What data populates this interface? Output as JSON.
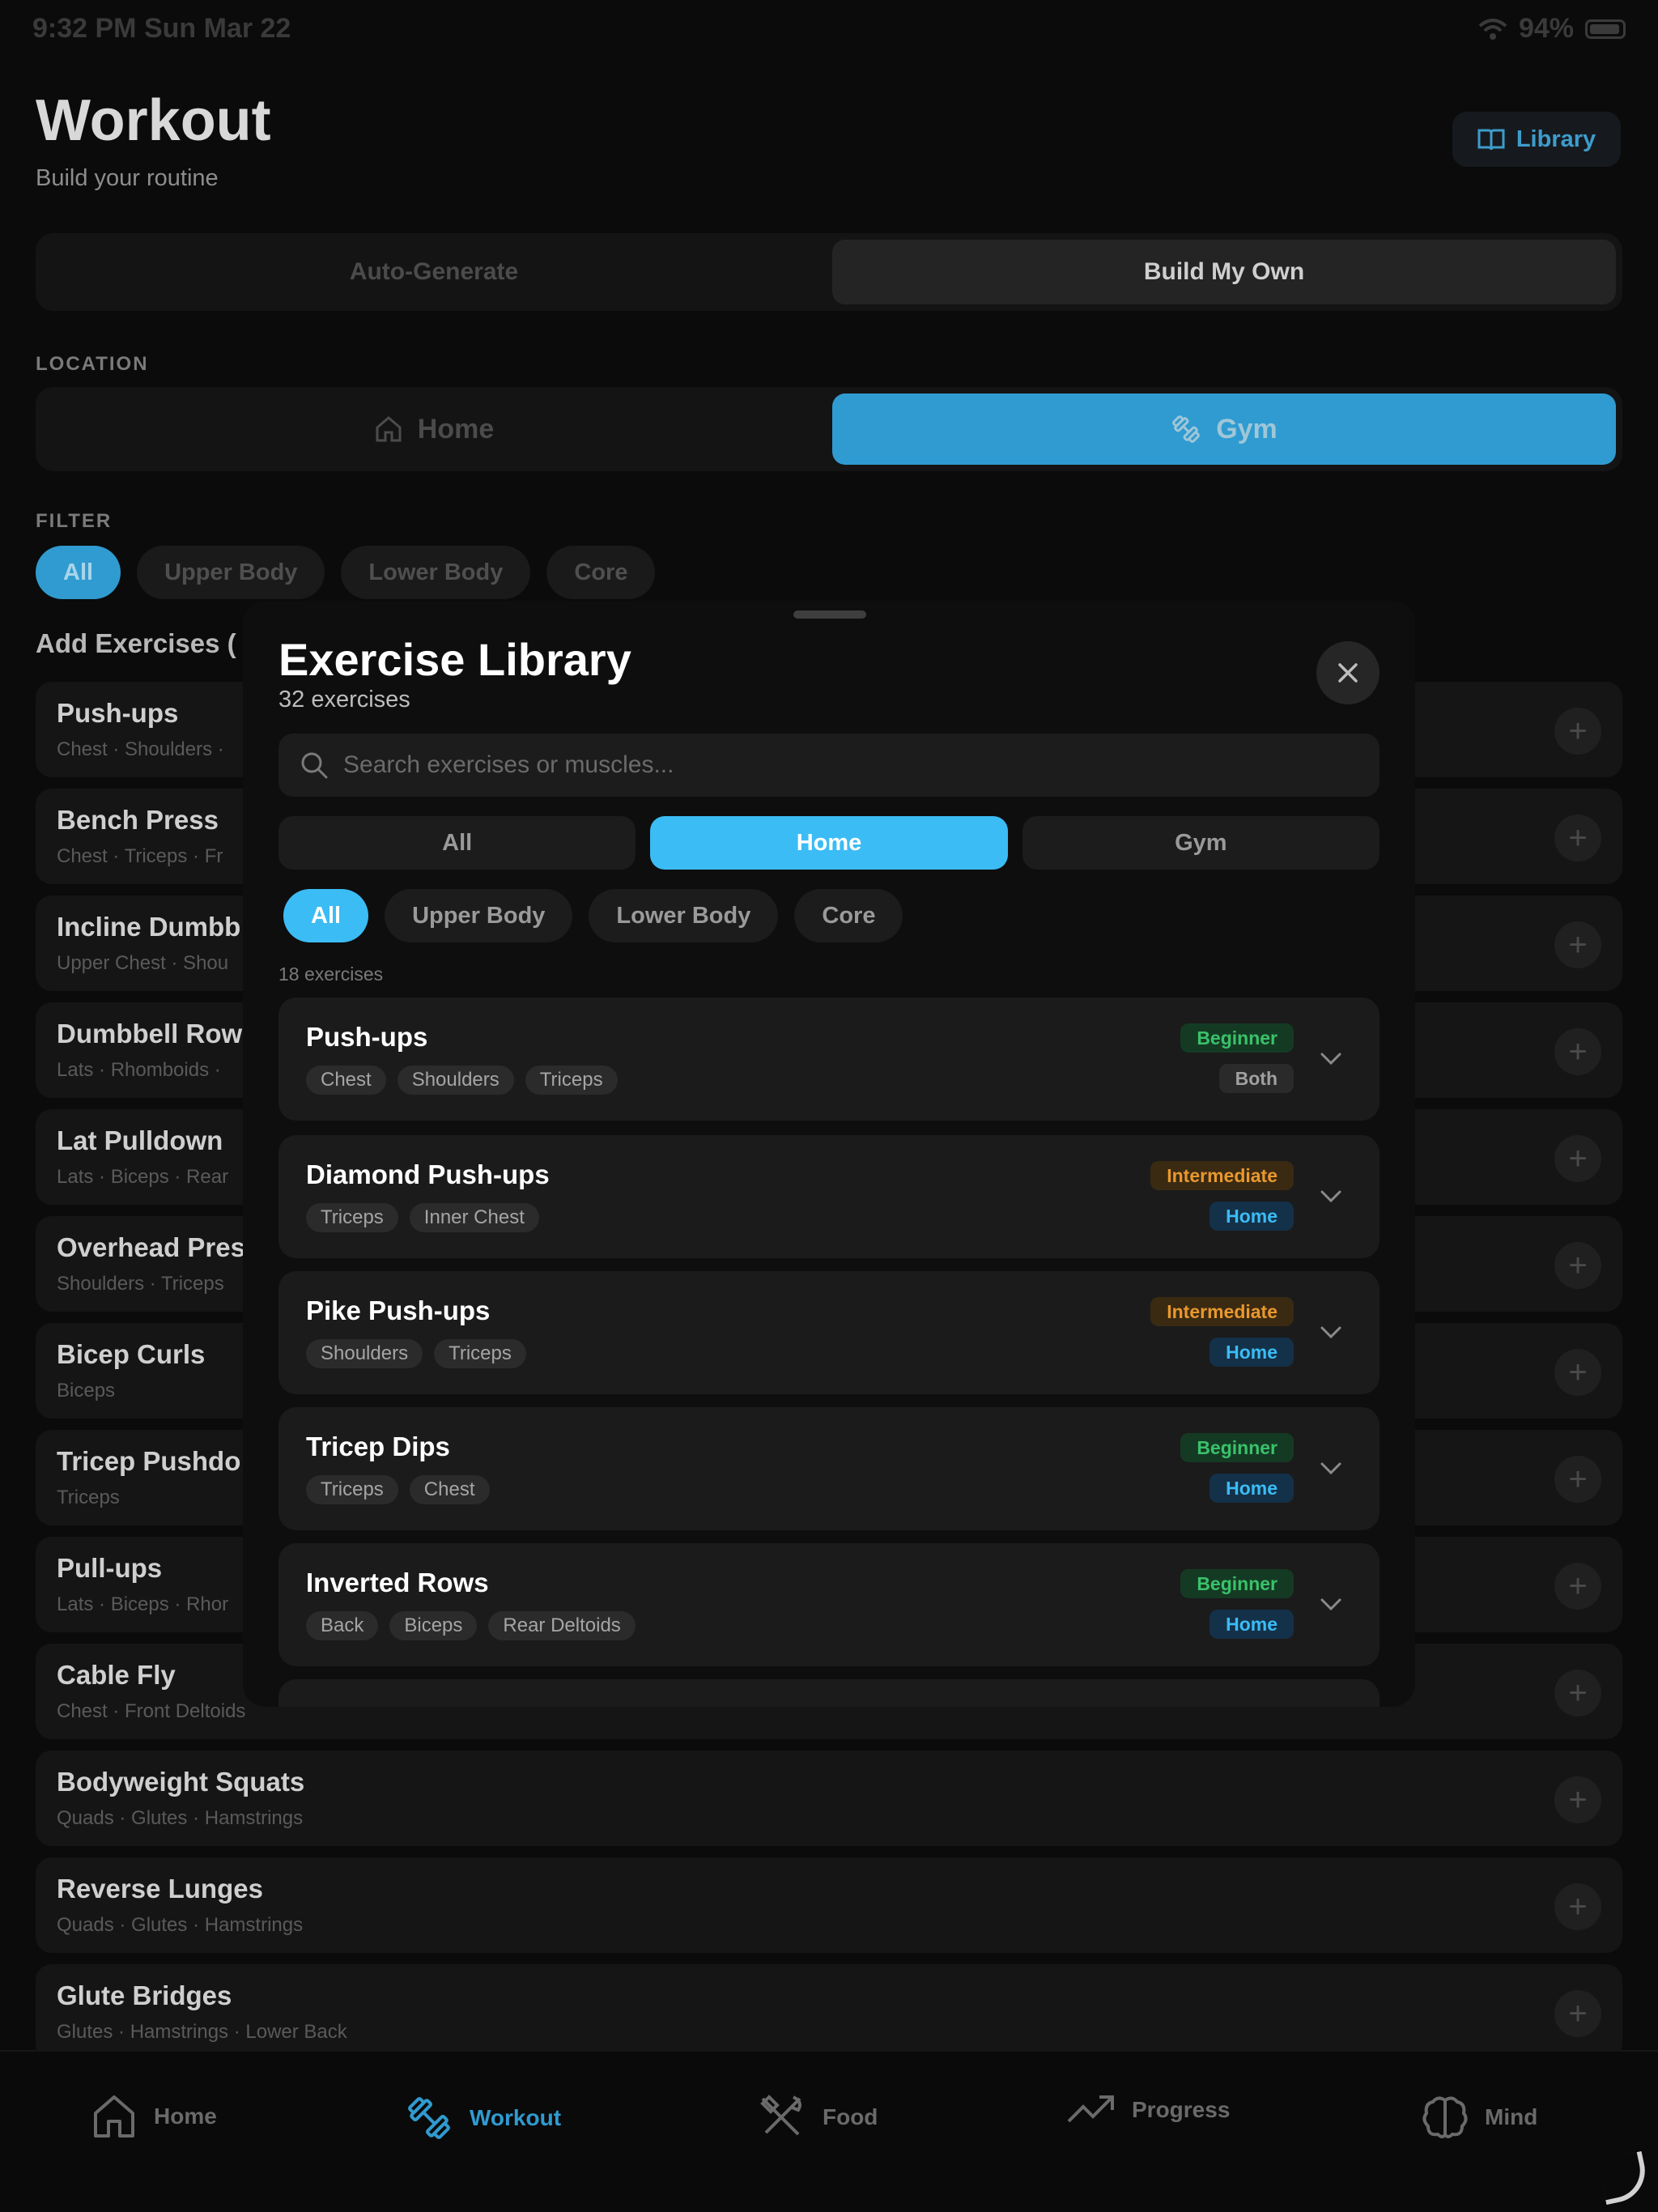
{
  "status_bar": {
    "time": "9:32 PM  Sun Mar 22",
    "battery": "94%"
  },
  "header": {
    "title": "Workout",
    "subtitle": "Build your routine",
    "library_label": "Library"
  },
  "mode_tabs": [
    "Auto-Generate",
    "Build My Own"
  ],
  "location": {
    "label": "LOCATION",
    "options": [
      "Home",
      "Gym"
    ],
    "selected": "Gym"
  },
  "filter": {
    "label": "FILTER",
    "options": [
      "All",
      "Upper Body",
      "Lower Body",
      "Core"
    ],
    "selected": "All"
  },
  "add_exercises_title": "Add Exercises (",
  "background_exercises": [
    {
      "name": "Push-ups",
      "muscles": "Chest · Shoulders ·"
    },
    {
      "name": "Bench Press",
      "muscles": "Chest · Triceps · Fr"
    },
    {
      "name": "Incline Dumbb",
      "muscles": "Upper Chest · Shou"
    },
    {
      "name": "Dumbbell Row",
      "muscles": "Lats · Rhomboids ·"
    },
    {
      "name": "Lat Pulldown",
      "muscles": "Lats · Biceps · Rear"
    },
    {
      "name": "Overhead Pres",
      "muscles": "Shoulders · Triceps"
    },
    {
      "name": "Bicep Curls",
      "muscles": "Biceps"
    },
    {
      "name": "Tricep Pushdo",
      "muscles": "Triceps"
    },
    {
      "name": "Pull-ups",
      "muscles": "Lats · Biceps · Rhor"
    },
    {
      "name": "Cable Fly",
      "muscles": "Chest · Front Deltoids"
    },
    {
      "name": "Bodyweight Squats",
      "muscles": "Quads · Glutes · Hamstrings"
    },
    {
      "name": "Reverse Lunges",
      "muscles": "Quads · Glutes · Hamstrings"
    },
    {
      "name": "Glute Bridges",
      "muscles": "Glutes · Hamstrings · Lower Back"
    }
  ],
  "sheet": {
    "title": "Exercise Library",
    "count": "32 exercises",
    "search_placeholder": "Search exercises or muscles...",
    "location_tabs": [
      "All",
      "Home",
      "Gym"
    ],
    "location_selected": "Home",
    "category_chips": [
      "All",
      "Upper Body",
      "Lower Body",
      "Core"
    ],
    "category_selected": "All",
    "result_count": "18 exercises",
    "exercises": [
      {
        "name": "Push-ups",
        "tags": [
          "Chest",
          "Shoulders",
          "Triceps"
        ],
        "difficulty": "Beginner",
        "location": "Both"
      },
      {
        "name": "Diamond Push-ups",
        "tags": [
          "Triceps",
          "Inner Chest"
        ],
        "difficulty": "Intermediate",
        "location": "Home"
      },
      {
        "name": "Pike Push-ups",
        "tags": [
          "Shoulders",
          "Triceps"
        ],
        "difficulty": "Intermediate",
        "location": "Home"
      },
      {
        "name": "Tricep Dips",
        "tags": [
          "Triceps",
          "Chest"
        ],
        "difficulty": "Beginner",
        "location": "Home"
      },
      {
        "name": "Inverted Rows",
        "tags": [
          "Back",
          "Biceps",
          "Rear Deltoids"
        ],
        "difficulty": "Beginner",
        "location": "Home"
      }
    ]
  },
  "tab_bar": {
    "items": [
      {
        "label": "Home",
        "icon": "house-icon"
      },
      {
        "label": "Workout",
        "icon": "dumbbell-icon"
      },
      {
        "label": "Food",
        "icon": "utensils-icon"
      },
      {
        "label": "Progress",
        "icon": "trending-up-icon"
      },
      {
        "label": "Mind",
        "icon": "brain-icon"
      }
    ],
    "selected": "Workout"
  },
  "colors": {
    "accent": "#3bbcf5",
    "accent_dim": "#2f9bd0",
    "beginner": "#39c26a",
    "intermediate": "#e9982e"
  }
}
